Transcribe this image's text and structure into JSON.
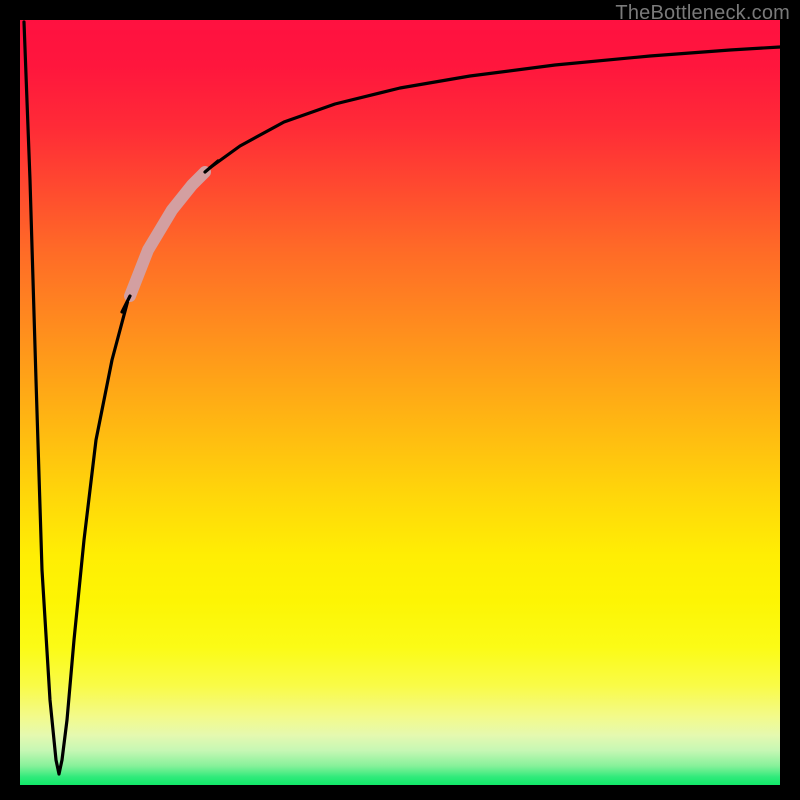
{
  "watermark": "TheBottleneck.com",
  "chart_data": {
    "type": "line",
    "title": "",
    "xlabel": "",
    "ylabel": "",
    "xlim": [
      0,
      100
    ],
    "ylim": [
      0,
      100
    ],
    "grid": false,
    "legend": false,
    "background_gradient": {
      "direction": "vertical",
      "stops": [
        {
          "pos": 0.0,
          "color": "#ff1140"
        },
        {
          "pos": 0.3,
          "color": "#ff6a27"
        },
        {
          "pos": 0.6,
          "color": "#ffd60a"
        },
        {
          "pos": 0.82,
          "color": "#fbfb16"
        },
        {
          "pos": 0.95,
          "color": "#c6f7b4"
        },
        {
          "pos": 1.0,
          "color": "#11e868"
        }
      ]
    },
    "series": [
      {
        "name": "bottleneck-curve",
        "color": "#000000",
        "x": [
          0.5,
          1.5,
          2.5,
          3.5,
          4.5,
          5.0,
          5.5,
          6.0,
          7.0,
          8.0,
          9.5,
          11.0,
          13.0,
          15.0,
          17.0,
          20.0,
          24.0,
          28.0,
          33.0,
          40.0,
          48.0,
          58.0,
          70.0,
          82.0,
          92.0,
          100.0
        ],
        "values": [
          99.0,
          72.0,
          42.0,
          18.0,
          5.0,
          1.5,
          5.5,
          12.0,
          24.0,
          35.0,
          47.0,
          55.0,
          63.0,
          69.0,
          73.5,
          78.5,
          83.0,
          86.0,
          88.5,
          90.7,
          92.3,
          93.6,
          94.6,
          95.2,
          95.6,
          95.8
        ]
      },
      {
        "name": "highlight-segment",
        "color": "#d39fa1",
        "thick": true,
        "x": [
          13.0,
          15.0,
          17.0,
          19.0,
          21.0
        ],
        "values": [
          63.0,
          69.0,
          73.5,
          77.0,
          79.8
        ]
      }
    ],
    "note": "Values read off plot at the axis precision implied (roughly integers). xlim/ylim are normalized since no tick labels are present."
  }
}
